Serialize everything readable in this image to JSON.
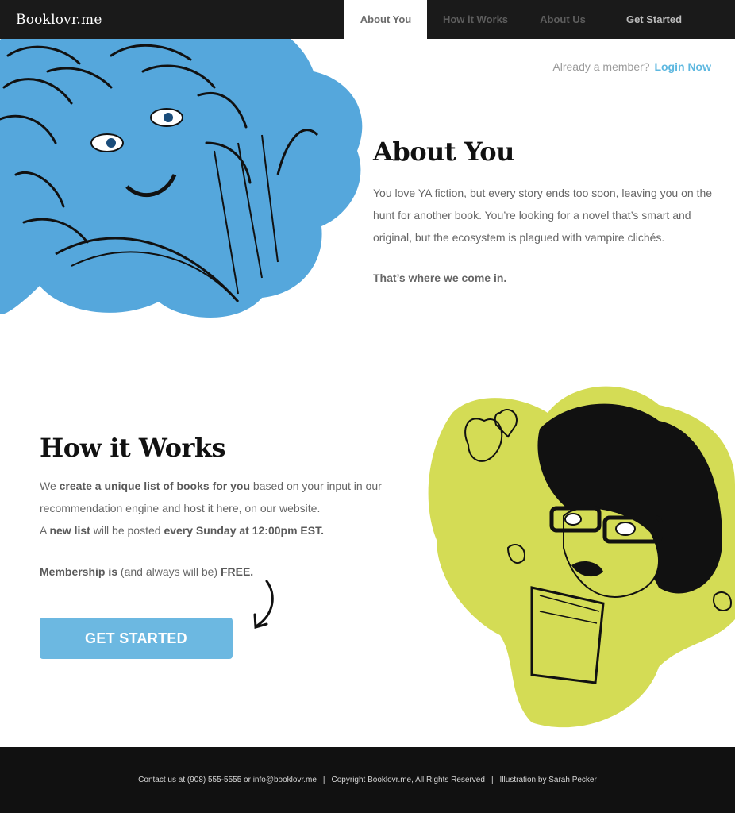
{
  "header": {
    "logo": "Booklovr.me",
    "nav": [
      {
        "label": "About You"
      },
      {
        "label": "How it Works"
      },
      {
        "label": "About Us"
      },
      {
        "label": "Get Started"
      }
    ]
  },
  "login": {
    "prompt": "Already a member?",
    "link": "Login Now"
  },
  "about": {
    "heading": "About You",
    "body": "You love YA fiction, but every story ends too soon, leaving you on the hunt for another book. You’re looking for a novel that’s smart and original, but the ecosystem is plagued with vampire clichés.",
    "emphasis": "That’s where we come in."
  },
  "how": {
    "heading": "How it Works",
    "line1_a": "We ",
    "line1_b": "create a unique list of books for you",
    "line1_c": " based on your input in our recommendation engine and host it here, on our website.",
    "line2_a": "A ",
    "line2_b": "new list",
    "line2_c": " will be posted ",
    "line2_d": "every Sunday at 12:00pm EST.",
    "member_a": "Membership is",
    "member_b": " (and always will be) ",
    "member_c": "FREE.",
    "cta": "GET STARTED"
  },
  "footer": {
    "contact": "Contact us at (908) 555-5555 or info@booklovr.me",
    "copyright": "Copyright Booklovr.me, All Rights Reserved",
    "credit": "Illustration by Sarah Pecker"
  },
  "colors": {
    "accent_blue": "#6cb8e1",
    "illustration_blue": "#55a7dc",
    "illustration_green": "#d4dc55",
    "nav_bg": "#1a1a1a",
    "footer_bg": "#111111"
  },
  "icons": [
    "curved-arrow-icon"
  ]
}
